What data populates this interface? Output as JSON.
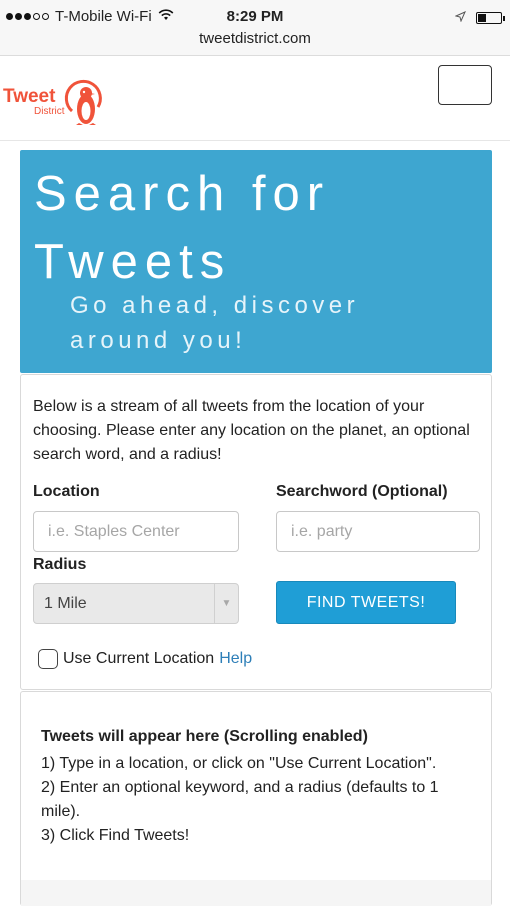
{
  "status_bar": {
    "carrier": "T-Mobile Wi-Fi",
    "time": "8:29 PM",
    "url": "tweetdistrict.com",
    "battery_level": 0.35,
    "wifi_icon": "wifi-icon",
    "location_icon": "location-arrow-icon"
  },
  "header": {
    "logo_word": "Tweet",
    "logo_sub": "District",
    "brand_color": "#f0533a",
    "menu_icon": "hamburger-menu-icon"
  },
  "hero": {
    "title": "Search for Tweets",
    "subtitle": "Go ahead, discover around you!",
    "bg_color": "#3ea6d0"
  },
  "form": {
    "intro": "Below is a stream of all tweets from the location of your choosing. Please enter any location on the planet, an optional search word, and a radius!",
    "location_label": "Location",
    "location_placeholder": "i.e. Staples Center",
    "searchword_label": "Searchword (Optional)",
    "searchword_placeholder": "i.e. party",
    "radius_label": "Radius",
    "radius_value": "1 Mile",
    "find_button": "FIND TWEETS!",
    "checkbox_label": "Use Current Location",
    "help_link": "Help",
    "accent_color": "#1f9ed6"
  },
  "tweets": {
    "title": "Tweets will appear here (Scrolling enabled)",
    "step1": "1) Type in a location, or click on \"Use Current Location\".",
    "step2": "2) Enter an optional keyword, and a radius (defaults to 1 mile).",
    "step3": "3) Click Find Tweets!"
  }
}
